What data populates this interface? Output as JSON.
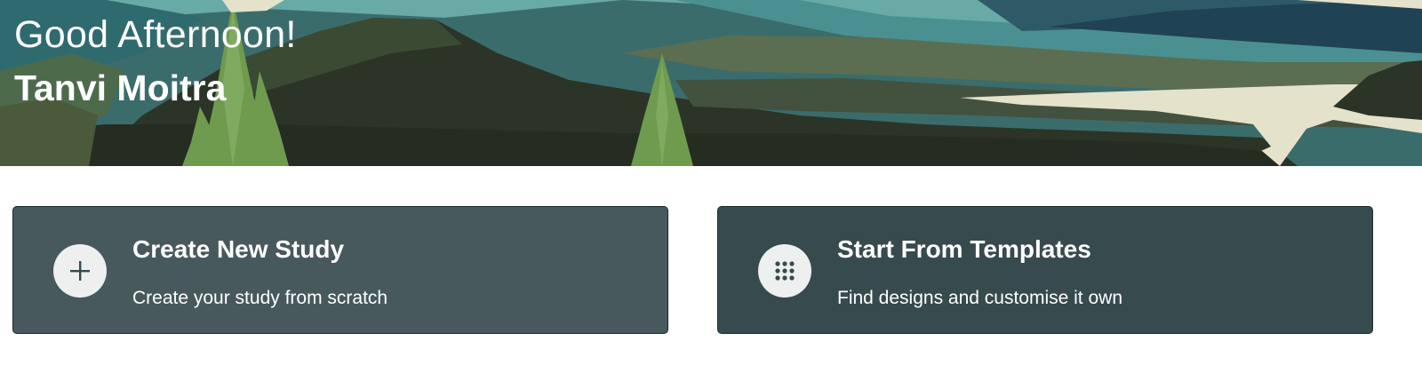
{
  "hero": {
    "greeting": "Good Afternoon!",
    "user_name": "Tanvi Moitra"
  },
  "cards": [
    {
      "title": "Create New Study",
      "subtitle": "Create your study from scratch",
      "icon": "plus-icon",
      "background": "#47595d"
    },
    {
      "title": "Start From Templates",
      "subtitle": "Find designs and customise it own",
      "icon": "grid-icon",
      "background": "#374a4d"
    }
  ],
  "colors": {
    "card_border": "#1e2a2d",
    "icon_circle": "#eef0f0",
    "icon_glyph": "#374a4d",
    "text": "#ffffff"
  }
}
